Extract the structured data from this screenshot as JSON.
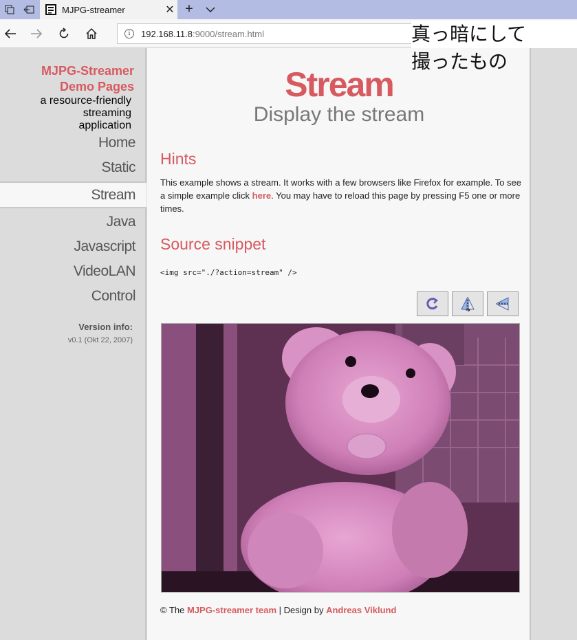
{
  "browser": {
    "tab_title": "MJPG-streamer",
    "new_tab_icon": "+",
    "url_host": "192.168.11.8",
    "url_rest": ":9000/stream.html"
  },
  "sidebar": {
    "brand_line1": "MJPG-Streamer",
    "brand_line2": "Demo Pages",
    "tagline_line1": "a resource-friendly streaming",
    "tagline_line2": "application",
    "items": [
      {
        "label": "Home"
      },
      {
        "label": "Static"
      },
      {
        "label": "Stream",
        "active": true
      },
      {
        "label": "Java"
      },
      {
        "label": "Javascript"
      },
      {
        "label": "VideoLAN"
      },
      {
        "label": "Control"
      }
    ],
    "version_heading": "Version info:",
    "version_text": "v0.1 (Okt 22, 2007)"
  },
  "main": {
    "title": "Stream",
    "subtitle": "Display the stream",
    "hints_heading": "Hints",
    "hints_text_1": "This example shows a stream. It works with a few browsers like Firefox for example. To see a simple example click ",
    "hints_link": "here",
    "hints_text_2": ". You may have to reload this page by pressing F5 one or more times.",
    "snippet_heading": "Source snippet",
    "snippet_code": "<img src=\"./?action=stream\" />",
    "footer_prefix": "© The ",
    "footer_team": "MJPG-streamer team",
    "footer_mid": " | Design by ",
    "footer_designer": "Andreas Viklund"
  },
  "annotation": {
    "line1": "真っ暗にして",
    "line2": "撮ったもの"
  },
  "colors": {
    "accent": "#d65a5f",
    "stream_tint": "#c86aa8"
  }
}
